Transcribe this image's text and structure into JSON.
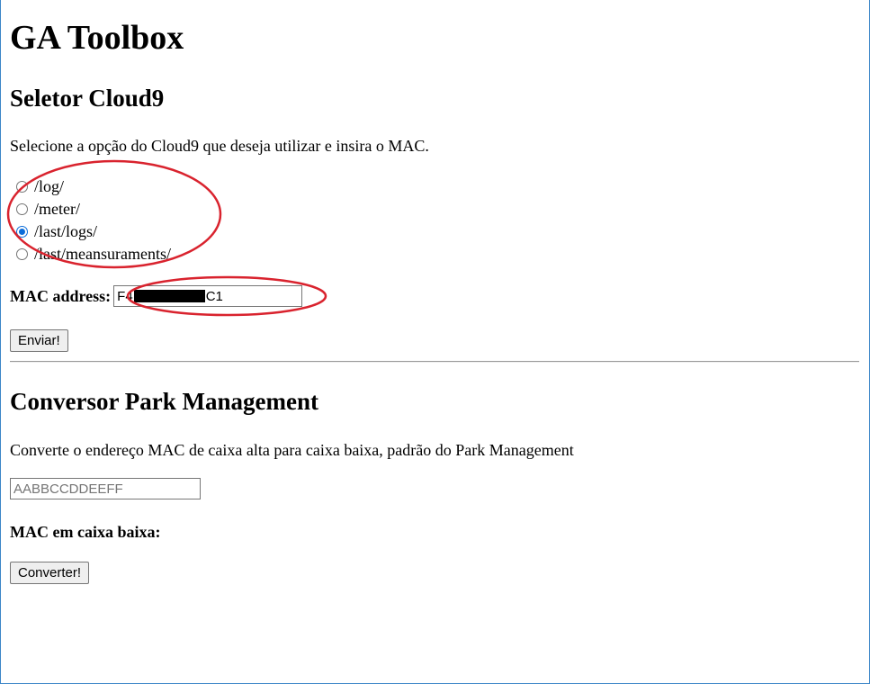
{
  "page": {
    "title": "GA Toolbox"
  },
  "selector": {
    "heading": "Seletor Cloud9",
    "description": "Selecione a opção do Cloud9 que deseja utilizar e insira o MAC.",
    "options": [
      {
        "label": "/log/",
        "checked": false
      },
      {
        "label": "/meter/",
        "checked": false
      },
      {
        "label": "/last/logs/",
        "checked": true
      },
      {
        "label": "/last/meansuraments/",
        "checked": false
      }
    ],
    "mac_label": "MAC address:",
    "mac_value_prefix": "F4",
    "mac_value_suffix": "C1",
    "submit_label": "Enviar!"
  },
  "converter": {
    "heading": "Conversor Park Management",
    "description": "Converte o endereço MAC de caixa alta para caixa baixa, padrão do Park Management",
    "input_placeholder": "AABBCCDDEEFF",
    "result_label": "MAC em caixa baixa:",
    "button_label": "Converter!"
  },
  "colors": {
    "annotation": "#d9232e",
    "radio_checked": "#0b6cd9",
    "window_border": "#3c86c8"
  }
}
